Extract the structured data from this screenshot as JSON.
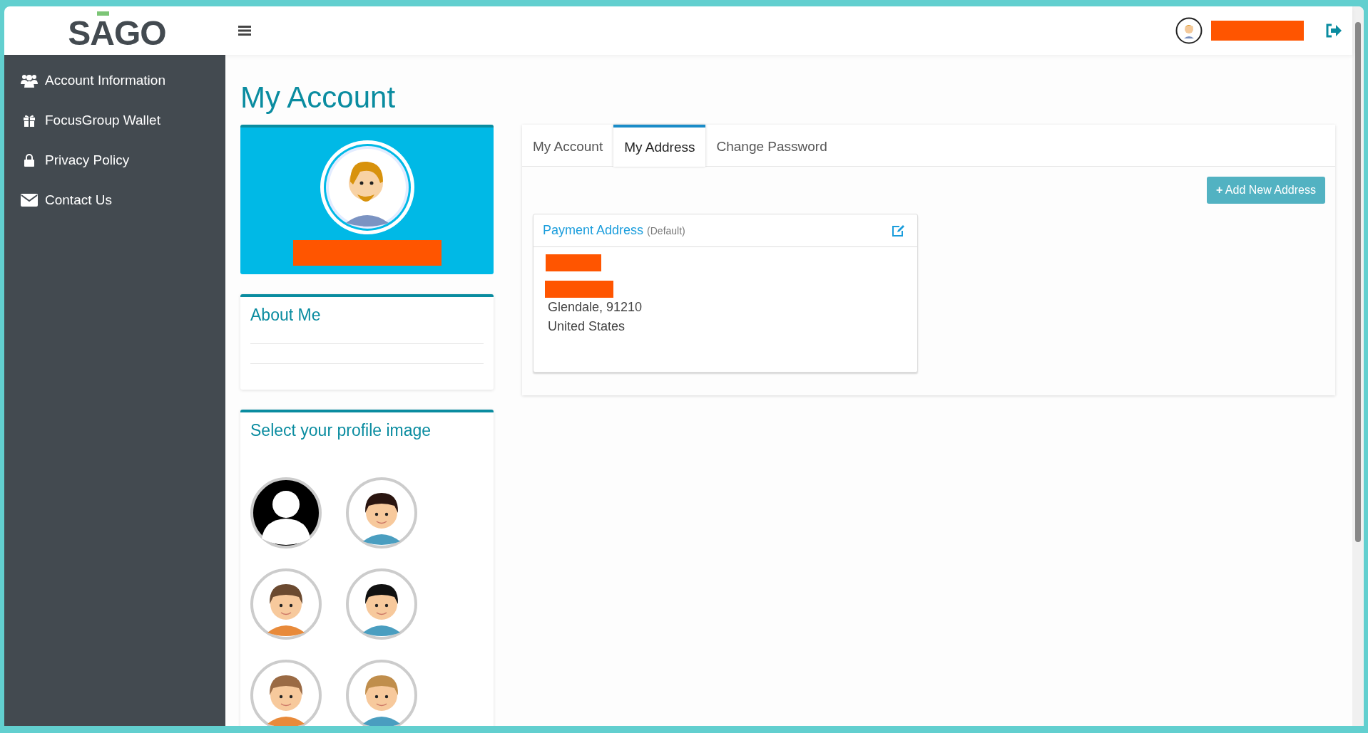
{
  "header": {
    "logo": "SAGO"
  },
  "sidebar": {
    "items": [
      {
        "label": "Account Information"
      },
      {
        "label": "FocusGroup Wallet"
      },
      {
        "label": "Privacy Policy"
      },
      {
        "label": "Contact Us"
      }
    ]
  },
  "page_title": "My Account",
  "about_me": {
    "title": "About Me"
  },
  "profile_images": {
    "title": "Select your profile image",
    "images": [
      {
        "kind": "silhouette"
      },
      {
        "kind": "cartoon"
      },
      {
        "kind": "cartoon"
      },
      {
        "kind": "cartoon"
      },
      {
        "kind": "cartoon"
      },
      {
        "kind": "cartoon"
      }
    ]
  },
  "tabs": [
    {
      "label": "My Account",
      "selected": false
    },
    {
      "label": "My Address",
      "selected": true
    },
    {
      "label": "Change Password",
      "selected": false
    }
  ],
  "add_button": {
    "icon": "+",
    "label": "Add New Address"
  },
  "address_card": {
    "title": "Payment Address",
    "tag": "(Default)",
    "lines": [
      {
        "kind": "redacted"
      },
      {
        "kind": "redacted"
      },
      {
        "kind": "text",
        "text": "Glendale, 91210"
      },
      {
        "kind": "text",
        "text": "United States"
      }
    ]
  }
}
